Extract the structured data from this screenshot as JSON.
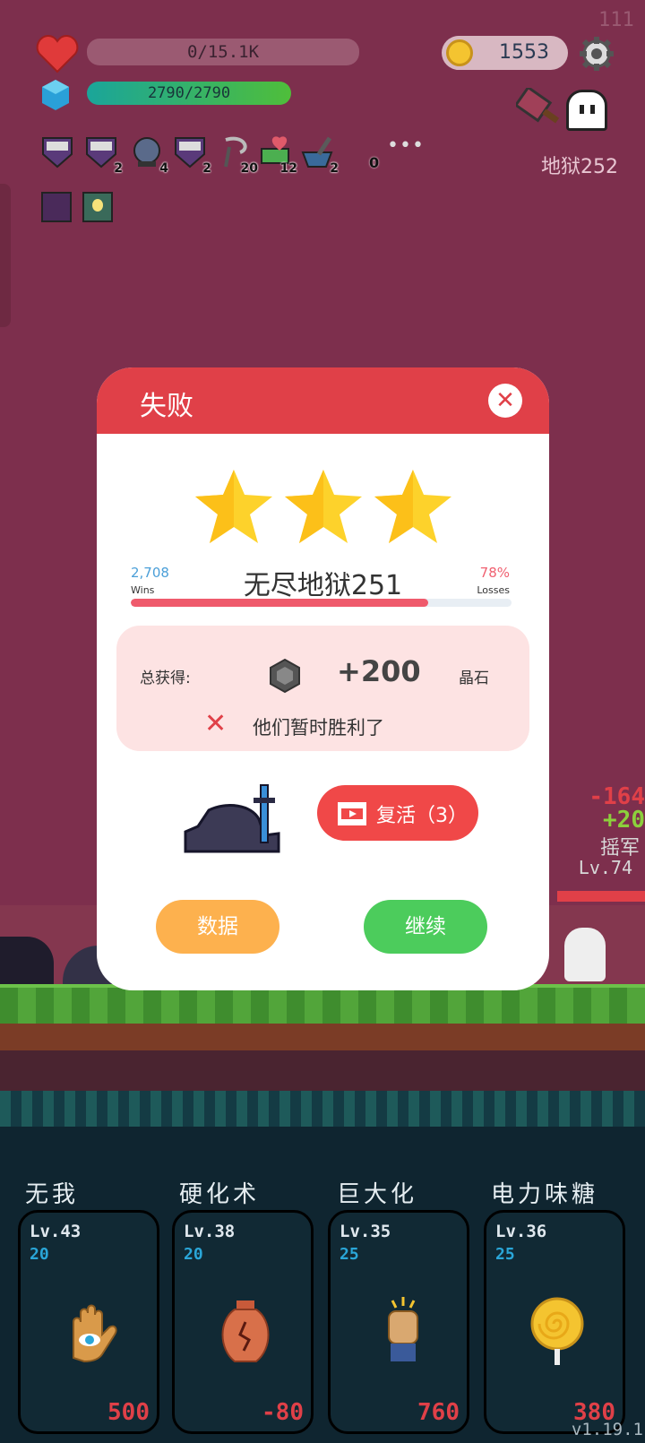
{
  "hud": {
    "hp_text": "0/15.1K",
    "hp_fill": 0.0,
    "mp_text": "2790/2790",
    "mp_fill": 1.0,
    "coins": "1553",
    "level_label": "地狱252",
    "top_counter": "111",
    "items": [
      {
        "icon": "scroll-icon",
        "count": ""
      },
      {
        "icon": "scroll-icon",
        "count": "2"
      },
      {
        "icon": "crystal-ball-icon",
        "count": "4"
      },
      {
        "icon": "scroll-icon",
        "count": "2"
      },
      {
        "icon": "sickle-icon",
        "count": "20"
      },
      {
        "icon": "heart-money-icon",
        "count": "12"
      },
      {
        "icon": "mortar-icon",
        "count": "2"
      }
    ],
    "item_zero": "0",
    "more": "•••"
  },
  "colors": {
    "dialog_header": "#e04048",
    "revive": "#f04848",
    "stats": "#fdb14e",
    "continue": "#4ccc5c",
    "progress": "#ef5a6c",
    "star": "#fdd22b"
  },
  "dialog": {
    "title": "失败",
    "close": "✕",
    "stars": 3,
    "wins_value": "2,708",
    "wins_label": "Wins",
    "losses_value": "78%",
    "losses_label": "Losses",
    "stage": "无尽地狱251",
    "win_rate": 0.78,
    "reward_label": "总获得:",
    "reward_amount": "+200",
    "reward_unit": "晶石",
    "lost_message": "他们暂时胜利了",
    "revive_label": "复活（3）",
    "stats_button": "数据",
    "continue_button": "继续"
  },
  "floating_text": {
    "damage": "-164",
    "gain": "+20",
    "enemy_name": "摇军",
    "enemy_level": "Lv.74"
  },
  "skills": [
    {
      "name": "无我",
      "level": "Lv.43",
      "sub": "20",
      "cost": "500",
      "icon": "eye-hand-icon"
    },
    {
      "name": "硬化术",
      "level": "Lv.38",
      "sub": "20",
      "cost": "-80",
      "icon": "cracked-vase-icon"
    },
    {
      "name": "巨大化",
      "level": "Lv.35",
      "sub": "25",
      "cost": "760",
      "icon": "fist-icon"
    },
    {
      "name": "电力味糖",
      "level": "Lv.36",
      "sub": "25",
      "cost": "380",
      "icon": "lollipop-icon"
    }
  ],
  "version": "v1.19.1"
}
